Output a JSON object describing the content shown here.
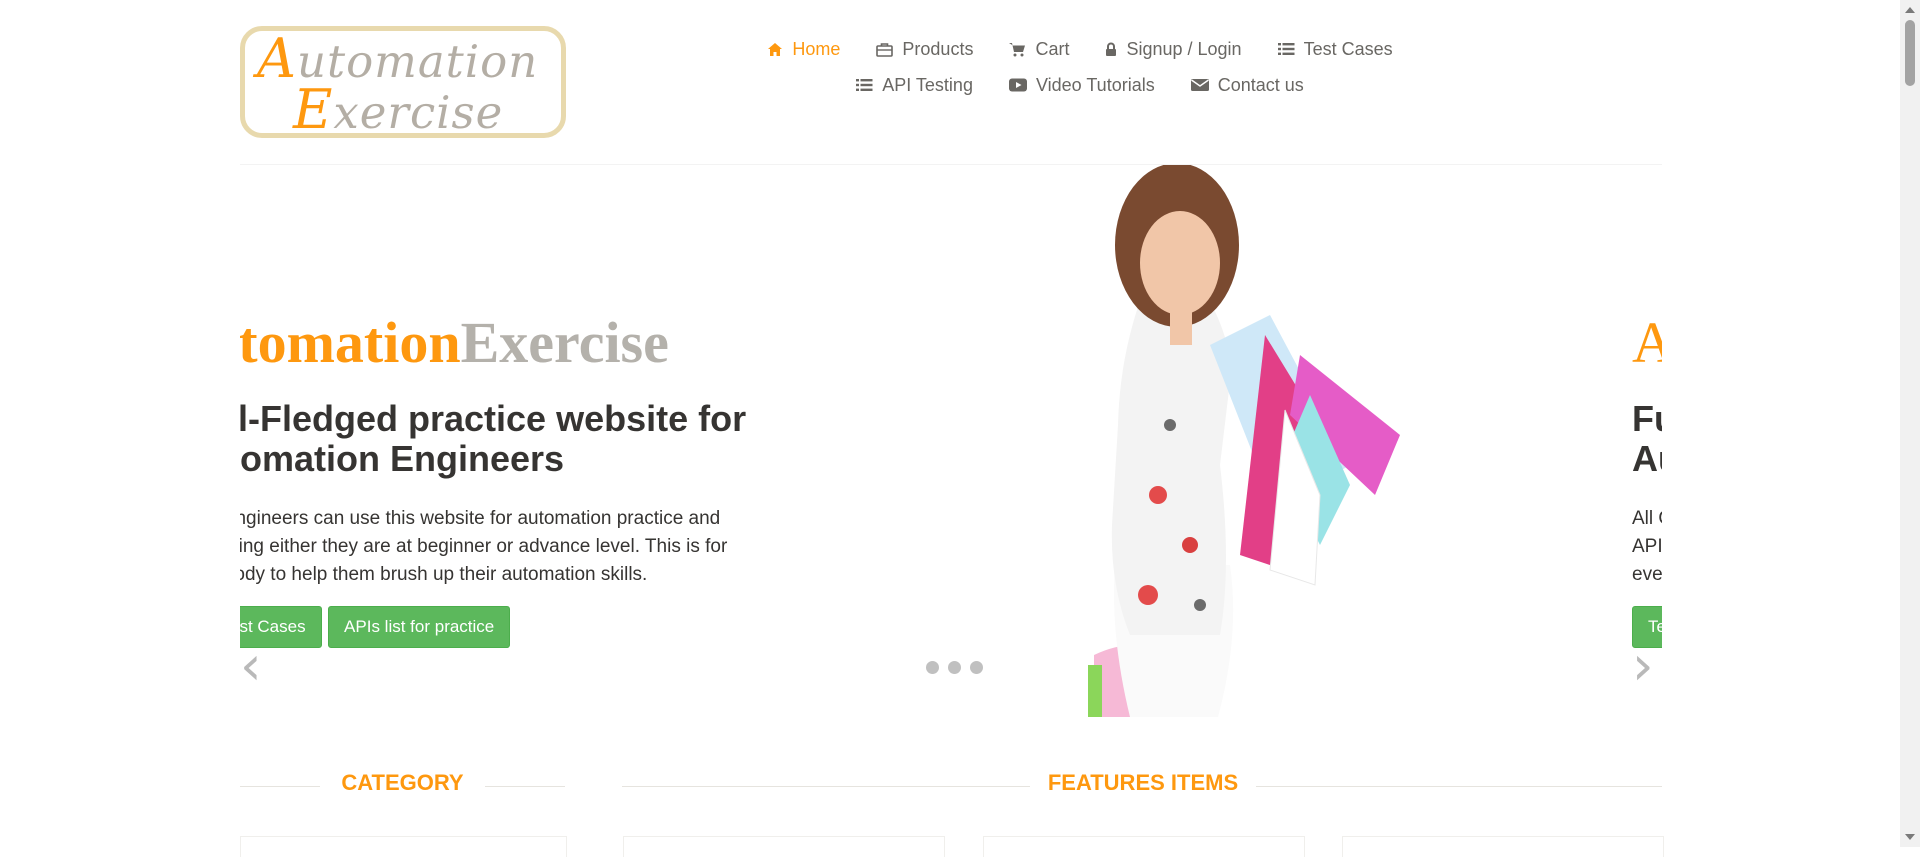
{
  "logo": {
    "line1_first": "A",
    "line1_rest": "utomation",
    "line2_first": "E",
    "line2_rest": "xercise"
  },
  "nav": [
    {
      "label": "Home",
      "icon": "home-icon",
      "active": true
    },
    {
      "label": "Products",
      "icon": "briefcase-icon"
    },
    {
      "label": "Cart",
      "icon": "cart-icon"
    },
    {
      "label": "Signup / Login",
      "icon": "lock-icon"
    },
    {
      "label": "Test Cases",
      "icon": "list-icon"
    },
    {
      "label": "API Testing",
      "icon": "list-icon"
    },
    {
      "label": "Video Tutorials",
      "icon": "youtube-icon"
    },
    {
      "label": "Contact us",
      "icon": "envelope-icon"
    }
  ],
  "slider": {
    "title_orange": "utomation",
    "title_gray": "Exercise",
    "subtitle_line1": "ull-Fledged practice website for",
    "subtitle_line2": "utomation Engineers",
    "desc_line1": "A engineers can use this website for automation practice and",
    "desc_line2": " testing either they are at beginner or advance level. This is for",
    "desc_line3": "rybody to help them brush up their automation skills.",
    "btn_test_cases": "est Cases",
    "btn_apis": "APIs list for practice",
    "next_title": "A",
    "next_sub1": "Fu",
    "next_sub2": "Au",
    "next_desc1": "All Q",
    "next_desc2": "API",
    "next_desc3": "eve",
    "next_btn": "Te",
    "prev_arrow": "‹",
    "next_arrow": "›",
    "indicator_count": 3
  },
  "sections": {
    "category": "CATEGORY",
    "features": "FEATURES ITEMS"
  },
  "colors": {
    "accent": "#FE980F",
    "button": "#5CB85C",
    "text": "#696763",
    "heading": "#363432"
  }
}
